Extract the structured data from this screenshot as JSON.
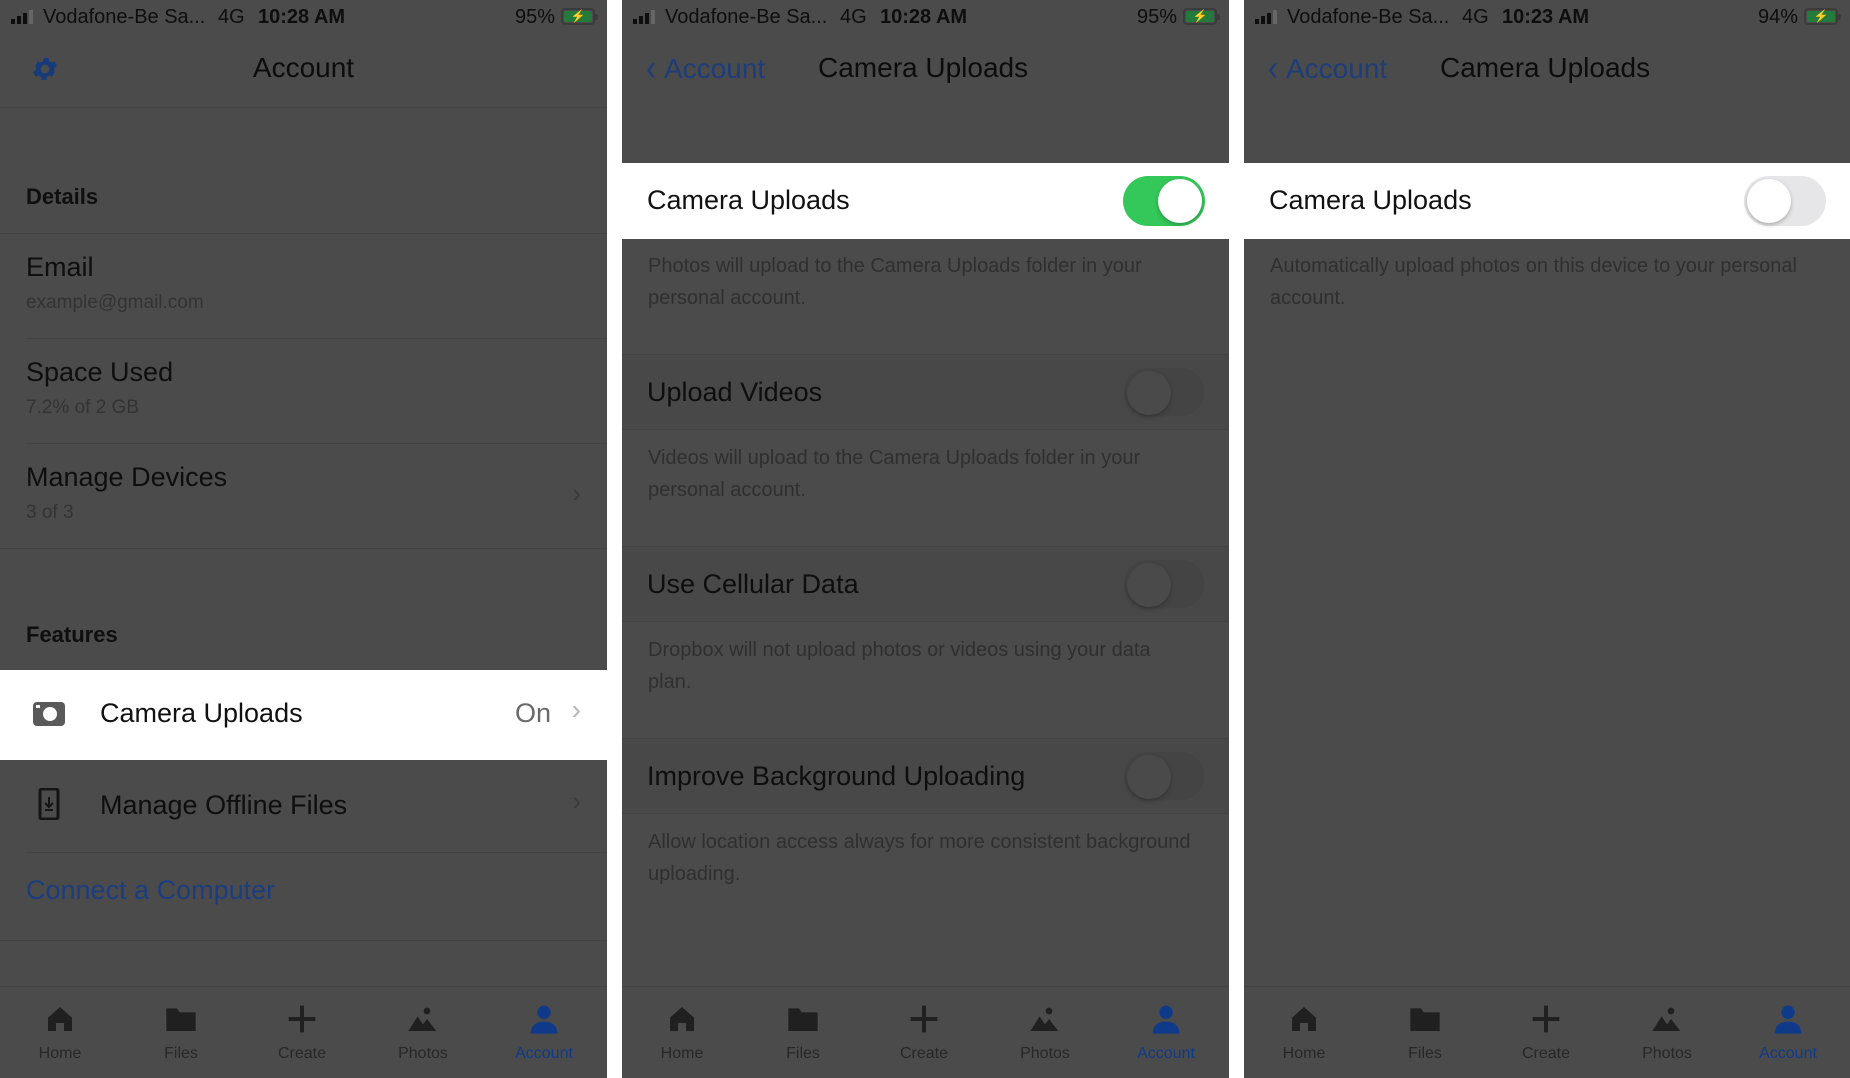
{
  "panels": [
    {
      "status": {
        "carrier": "Vodafone-Be Sa...",
        "network": "4G",
        "time": "10:28 AM",
        "battery_pct": "95%"
      },
      "nav": {
        "title": "Account",
        "left_icon": "gear-icon"
      },
      "sections": {
        "details_header": "Details",
        "email": {
          "title": "Email",
          "value": "example@gmail.com"
        },
        "space_used": {
          "title": "Space Used",
          "value": "7.2% of 2 GB"
        },
        "manage_devices": {
          "title": "Manage Devices",
          "value": "3 of 3"
        },
        "features_header": "Features",
        "camera_uploads": {
          "title": "Camera Uploads",
          "value": "On"
        },
        "offline_files": {
          "title": "Manage Offline Files"
        },
        "connect_computer": "Connect a Computer"
      }
    },
    {
      "status": {
        "carrier": "Vodafone-Be Sa...",
        "network": "4G",
        "time": "10:28 AM",
        "battery_pct": "95%"
      },
      "nav": {
        "back_label": "Account",
        "title": "Camera Uploads"
      },
      "settings": [
        {
          "label": "Camera Uploads",
          "on": true,
          "description": "Photos will upload to the Camera Uploads folder in your personal account."
        },
        {
          "label": "Upload Videos",
          "on": false,
          "description": "Videos will upload to the Camera Uploads folder in your personal account."
        },
        {
          "label": "Use Cellular Data",
          "on": false,
          "description": "Dropbox will not upload photos or videos using your data plan."
        },
        {
          "label": "Improve Background Uploading",
          "on": false,
          "description": "Allow location access always for more consistent background uploading."
        }
      ]
    },
    {
      "status": {
        "carrier": "Vodafone-Be Sa...",
        "network": "4G",
        "time": "10:23 AM",
        "battery_pct": "94%"
      },
      "nav": {
        "back_label": "Account",
        "title": "Camera Uploads"
      },
      "settings": [
        {
          "label": "Camera Uploads",
          "on": false,
          "description": "Automatically upload photos on this device to your personal account."
        }
      ]
    }
  ],
  "tabbar": {
    "tabs": [
      {
        "label": "Home",
        "icon": "home-icon"
      },
      {
        "label": "Files",
        "icon": "folder-icon"
      },
      {
        "label": "Create",
        "icon": "plus-icon"
      },
      {
        "label": "Photos",
        "icon": "photos-icon"
      },
      {
        "label": "Account",
        "icon": "person-icon",
        "active": true
      }
    ]
  },
  "colors": {
    "accent": "#1b3d7f",
    "toggle_on": "#34c759",
    "dim_background": "#4b4b4b"
  }
}
